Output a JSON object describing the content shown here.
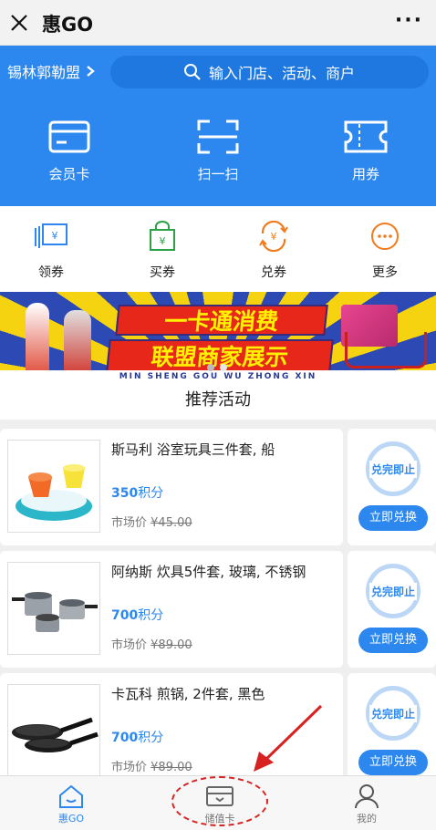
{
  "titlebar": {
    "title": "惠GO",
    "more": "···"
  },
  "header": {
    "city": "锡林郭勒盟",
    "search_placeholder": "输入门店、活动、商户",
    "actions": [
      {
        "label": "会员卡",
        "icon": "member-card-icon"
      },
      {
        "label": "扫一扫",
        "icon": "scan-icon"
      },
      {
        "label": "用券",
        "icon": "ticket-icon"
      }
    ]
  },
  "quick_actions": [
    {
      "label": "领券",
      "icon": "get-coupon-icon",
      "color": "#2c87ee"
    },
    {
      "label": "买券",
      "icon": "buy-coupon-icon",
      "color": "#2ba245"
    },
    {
      "label": "兑券",
      "icon": "exchange-coupon-icon",
      "color": "#f07c1d"
    },
    {
      "label": "更多",
      "icon": "more-icon",
      "color": "#f07c1d"
    }
  ],
  "banner": {
    "line1": "一卡通消费",
    "line2": "联盟商家展示",
    "footer": "MIN SHENG GOU WU ZHONG XIN"
  },
  "section_title": "推荐活动",
  "products": [
    {
      "name": "斯马利 浴室玩具三件套, 船",
      "points": "350",
      "points_unit": "积分",
      "market_label": "市场价",
      "market_price": "¥45.00",
      "stamp": "兑完即止",
      "button": "立即兑换"
    },
    {
      "name": "阿纳斯 炊具5件套, 玻璃, 不锈钢",
      "points": "700",
      "points_unit": "积分",
      "market_label": "市场价",
      "market_price": "¥89.00",
      "stamp": "兑完即止",
      "button": "立即兑换"
    },
    {
      "name": "卡瓦科 煎锅, 2件套, 黑色",
      "points": "700",
      "points_unit": "积分",
      "market_label": "市场价",
      "market_price": "¥89.00",
      "stamp": "兑完即止",
      "button": "立即兑换"
    }
  ],
  "tabbar": [
    {
      "label": "惠GO",
      "icon": "home-icon",
      "active": true
    },
    {
      "label": "储值卡",
      "icon": "stored-value-card-icon",
      "active": false
    },
    {
      "label": "我的",
      "icon": "profile-icon",
      "active": false
    }
  ],
  "colors": {
    "primary": "#2c87ee",
    "annotation": "#d82222"
  }
}
